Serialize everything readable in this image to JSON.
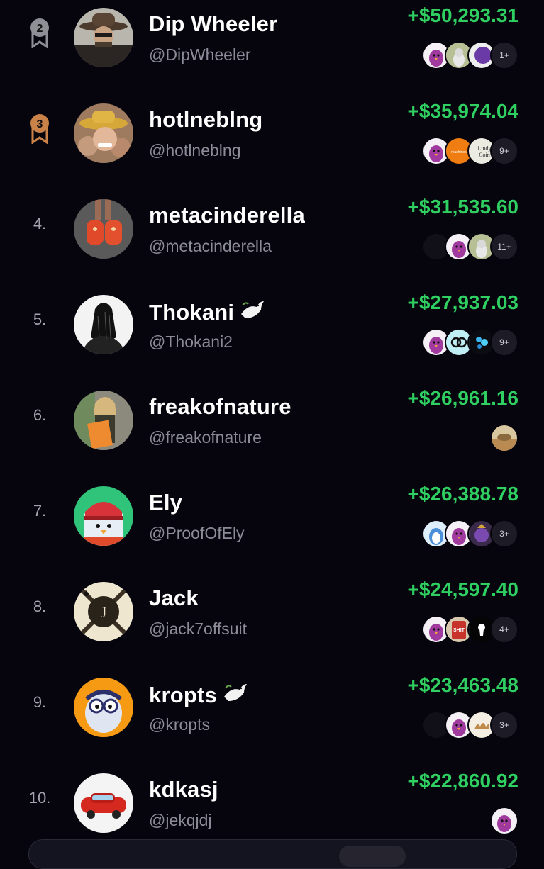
{
  "rows": [
    {
      "rank": "2",
      "medal": true,
      "medal_color": "#8f8f96",
      "name": "Dip Wheeler",
      "dove": false,
      "handle": "@DipWheeler",
      "amount": "+$50,293.31",
      "more": "1+",
      "avatar_icon": "avatar-cowboy-hat-man",
      "tokens": [
        "pudgy-penguin-token",
        "penguin-scene-token",
        "purple-token"
      ]
    },
    {
      "rank": "3",
      "medal": true,
      "medal_color": "#c98248",
      "name": "hotlneblng",
      "dove": false,
      "handle": "@hotlneblng",
      "amount": "+$35,974.04",
      "more": "9+",
      "avatar_icon": "avatar-gold-hat-man",
      "tokens": [
        "pudgy-penguin-token",
        "orange-machines-token",
        "lindy-coin-token"
      ],
      "token_texts": [
        "",
        "machines",
        "Lindy Coin"
      ]
    },
    {
      "rank": "4.",
      "medal": false,
      "name": "metacinderella",
      "dove": false,
      "handle": "@metacinderella",
      "amount": "+$31,535.60",
      "more": "11+",
      "avatar_icon": "avatar-red-shoes",
      "tokens": [
        "empty-token",
        "pudgy-penguin-token",
        "penguin-scene-token"
      ]
    },
    {
      "rank": "5.",
      "medal": false,
      "name": "Thokani",
      "dove": true,
      "handle": "@Thokani2",
      "amount": "+$27,937.03",
      "more": "9+",
      "avatar_icon": "avatar-sketch-figure",
      "tokens": [
        "pudgy-penguin-token",
        "cyan-swirl-token",
        "blue-bubbles-token"
      ]
    },
    {
      "rank": "6.",
      "medal": false,
      "name": "freakofnature",
      "dove": false,
      "handle": "@freakofnature",
      "amount": "+$26,961.16",
      "more": "",
      "avatar_icon": "avatar-woman-carrots",
      "tokens": [
        "landscape-token"
      ]
    },
    {
      "rank": "7.",
      "medal": false,
      "name": "Ely",
      "dove": false,
      "handle": "@ProofOfEly",
      "amount": "+$26,388.78",
      "more": "3+",
      "avatar_icon": "avatar-pudgy-penguin-red-hat",
      "tokens": [
        "blue-penguin-token",
        "pudgy-penguin-token",
        "purple-creature-token"
      ]
    },
    {
      "rank": "8.",
      "medal": false,
      "name": "Jack",
      "dove": false,
      "handle": "@jack7offsuit",
      "amount": "+$24,597.40",
      "more": "4+",
      "avatar_icon": "avatar-playing-card-jack",
      "tokens": [
        "pudgy-penguin-token",
        "shit-can-token",
        "keyhole-token"
      ],
      "token_texts": [
        "",
        "SHIT",
        ""
      ]
    },
    {
      "rank": "9.",
      "medal": false,
      "name": "kropts",
      "dove": true,
      "handle": "@kropts",
      "amount": "+$23,463.48",
      "more": "3+",
      "avatar_icon": "avatar-cartoon-owl",
      "tokens": [
        "empty-token",
        "pudgy-penguin-token",
        "camel-token"
      ]
    },
    {
      "rank": "10.",
      "medal": false,
      "name": "kdkasj",
      "dove": false,
      "handle": "@jekqjdj",
      "amount": "+$22,860.92",
      "more": "",
      "avatar_icon": "avatar-red-race-car",
      "tokens": [
        "pudgy-penguin-token"
      ]
    }
  ],
  "colors": {
    "background": "#06050d",
    "gain": "#2fd061",
    "handle": "#8c8c99",
    "rank": "#a3a3ad"
  }
}
